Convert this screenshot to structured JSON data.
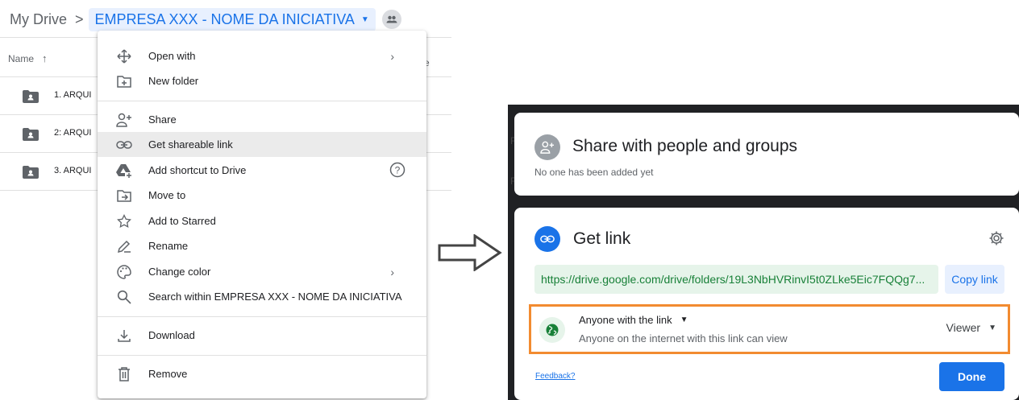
{
  "breadcrumb": {
    "root": "My Drive",
    "separator": ">",
    "current": "EMPRESA XXX - NOME DA INICIATIVA",
    "shared_icon": "people-icon"
  },
  "file_list": {
    "header_name": "Name",
    "sort_arrow": "↑",
    "header_extra": "e",
    "rows": [
      {
        "label": "1. ARQUI"
      },
      {
        "label": "2: ARQUI"
      },
      {
        "label": "3. ARQUI"
      }
    ]
  },
  "menu": {
    "items": [
      {
        "label": "Open with",
        "icon": "move-cross-icon",
        "has_submenu": true
      },
      {
        "label": "New folder",
        "icon": "folder-plus-icon"
      },
      {
        "label": "Share",
        "icon": "person-add-icon"
      },
      {
        "label": "Get shareable link",
        "icon": "link-icon",
        "highlighted": true
      },
      {
        "label": "Add shortcut to Drive",
        "icon": "drive-shortcut-icon",
        "has_help": true
      },
      {
        "label": "Move to",
        "icon": "move-folder-icon"
      },
      {
        "label": "Add to Starred",
        "icon": "star-icon"
      },
      {
        "label": "Rename",
        "icon": "pencil-icon"
      },
      {
        "label": "Change color",
        "icon": "palette-icon",
        "has_submenu": true
      },
      {
        "label": "Search within EMPRESA XXX - NOME DA INICIATIVA",
        "icon": "search-icon"
      },
      {
        "label": "Download",
        "icon": "download-icon"
      },
      {
        "label": "Remove",
        "icon": "trash-icon"
      }
    ],
    "submenu_arrow": "›",
    "help_glyph": "?"
  },
  "dialog": {
    "share": {
      "title": "Share with people and groups",
      "subtitle": "No one has been added yet"
    },
    "link": {
      "title": "Get link",
      "url": "https://drive.google.com/drive/folders/19L3NbHVRinvI5t0ZLke5Eic7FQQg7...",
      "copy_label": "Copy link",
      "access_title": "Anyone with the link",
      "access_subtitle": "Anyone on the internet with this link can view",
      "role": "Viewer",
      "feedback": "Feedback?",
      "done": "Done"
    },
    "highlight_color": "#f28b30",
    "accent_color": "#1a73e8"
  }
}
